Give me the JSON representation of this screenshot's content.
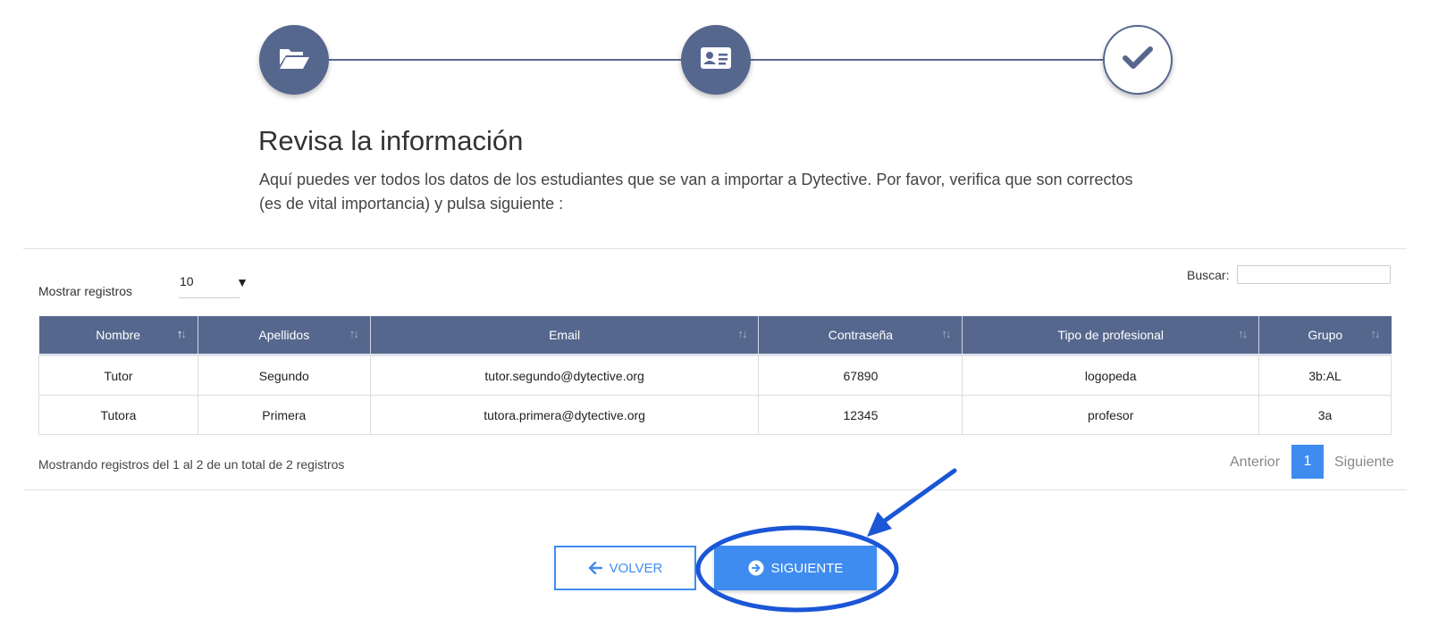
{
  "stepper": {
    "steps": [
      {
        "icon": "folder-open-icon",
        "state": "done"
      },
      {
        "icon": "id-card-icon",
        "state": "done"
      },
      {
        "icon": "check-icon",
        "state": "current"
      }
    ]
  },
  "heading": {
    "title": "Revisa la información",
    "description": "Aquí puedes ver todos los datos de los estudiantes que se van a importar a Dytective. Por favor, verifica que son correctos (es de vital importancia) y pulsa siguiente :"
  },
  "controls": {
    "length_label": "Mostrar registros",
    "length_value": "10",
    "search_label": "Buscar:",
    "search_value": ""
  },
  "table": {
    "columns": [
      "Nombre",
      "Apellidos",
      "Email",
      "Contraseña",
      "Tipo de profesional",
      "Grupo"
    ],
    "rows": [
      [
        "Tutor",
        "Segundo",
        "tutor.segundo@dytective.org",
        "67890",
        "logopeda",
        "3b:AL"
      ],
      [
        "Tutora",
        "Primera",
        "tutora.primera@dytective.org",
        "12345",
        "profesor",
        "3a"
      ]
    ]
  },
  "footer": {
    "info": "Mostrando registros del 1 al 2 de un total de 2 registros",
    "prev": "Anterior",
    "page": "1",
    "next": "Siguiente"
  },
  "buttons": {
    "back_label": "VOLVER",
    "next_label": "SIGUIENTE"
  },
  "colors": {
    "primary": "#56678e",
    "accent": "#3f8cf0",
    "annotation": "#1a56d6"
  }
}
